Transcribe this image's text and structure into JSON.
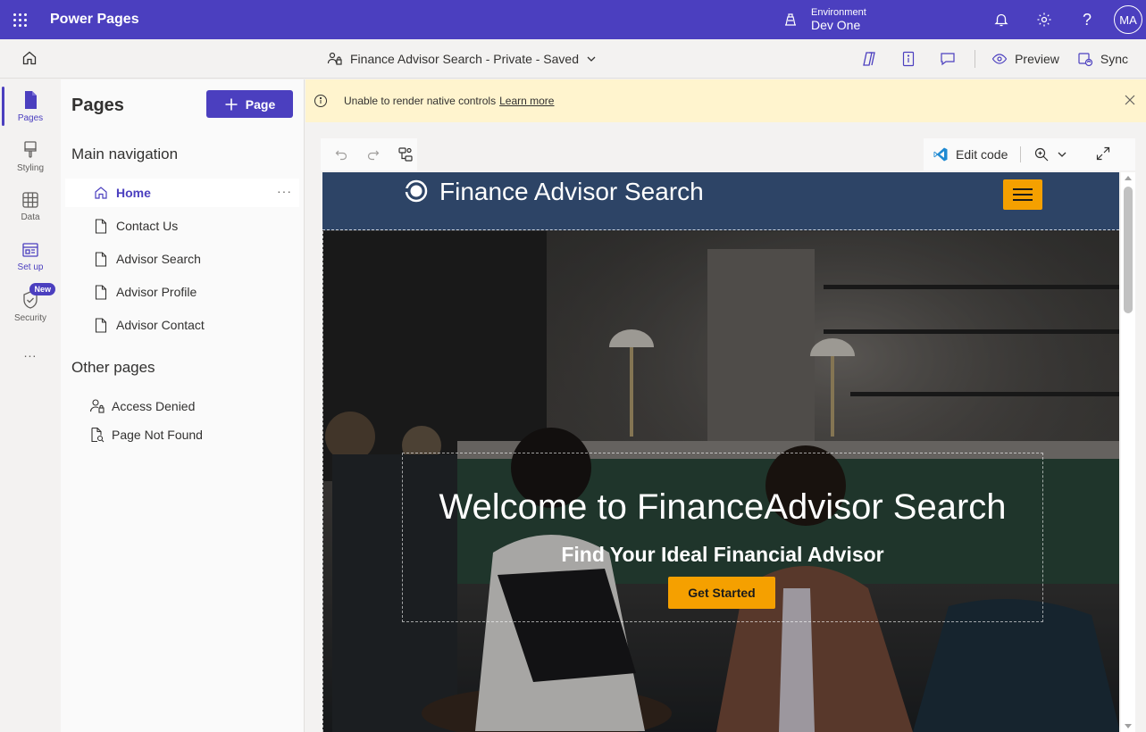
{
  "app": {
    "title": "Power Pages"
  },
  "environment": {
    "label": "Environment",
    "name": "Dev One"
  },
  "user": {
    "initials": "MA"
  },
  "commandbar": {
    "page_status": "Finance Advisor Search - Private - Saved",
    "preview_label": "Preview",
    "sync_label": "Sync"
  },
  "rail": {
    "items": [
      {
        "label": "Pages",
        "icon": "page-icon"
      },
      {
        "label": "Styling",
        "icon": "paintbrush-icon"
      },
      {
        "label": "Data",
        "icon": "table-icon"
      },
      {
        "label": "Set up",
        "icon": "setup-icon"
      },
      {
        "label": "Security",
        "icon": "shield-icon",
        "badge": "New"
      }
    ],
    "more": "..."
  },
  "pages_panel": {
    "title": "Pages",
    "add_button": "Page",
    "main_nav_title": "Main navigation",
    "main_nav": [
      {
        "label": "Home",
        "icon": "home-icon",
        "selected": true
      },
      {
        "label": "Contact Us",
        "icon": "document-icon"
      },
      {
        "label": "Advisor Search",
        "icon": "document-icon"
      },
      {
        "label": "Advisor Profile",
        "icon": "document-icon"
      },
      {
        "label": "Advisor Contact",
        "icon": "document-icon"
      }
    ],
    "more_dots": "···",
    "other_title": "Other pages",
    "other": [
      {
        "label": "Access Denied",
        "icon": "person-lock-icon"
      },
      {
        "label": "Page Not Found",
        "icon": "document-search-icon"
      }
    ]
  },
  "banner": {
    "message": "Unable to render native controls",
    "link": "Learn more"
  },
  "canvas_toolbar": {
    "edit_code": "Edit code"
  },
  "site": {
    "title": "Finance Advisor Search",
    "hero_heading": "Welcome to FinanceAdvisor Search",
    "hero_subheading": "Find Your Ideal Financial Advisor",
    "cta": "Get Started"
  },
  "colors": {
    "brand": "#4b3fbf",
    "site_header": "#2d4466",
    "accent": "#f5a000",
    "banner": "#fff4ce"
  }
}
